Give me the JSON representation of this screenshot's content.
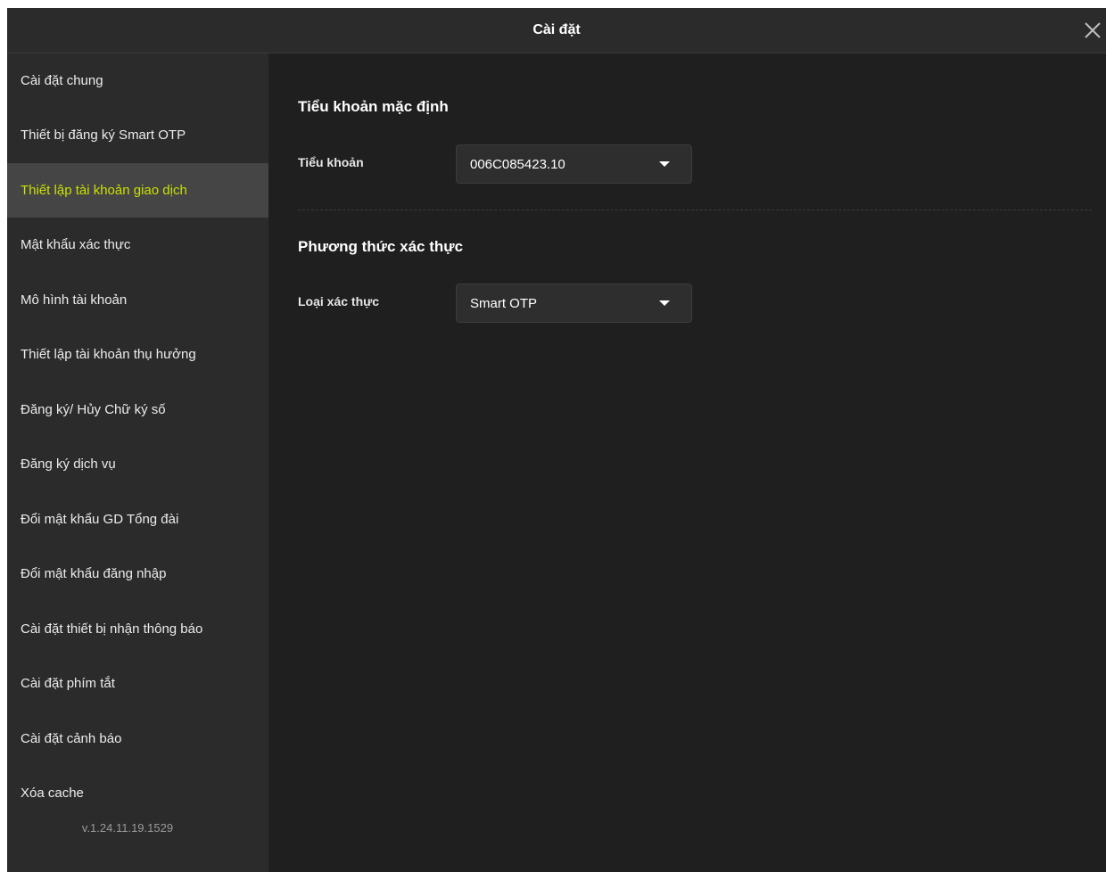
{
  "window": {
    "title": "Cài đặt",
    "close_icon": "close-icon"
  },
  "sidebar": {
    "items": [
      {
        "label": "Cài đặt chung"
      },
      {
        "label": "Thiết bị đăng ký Smart OTP"
      },
      {
        "label": "Thiết lập tài khoản giao dịch",
        "active": true
      },
      {
        "label": "Mật khẩu xác thực"
      },
      {
        "label": "Mô hình tài khoản"
      },
      {
        "label": "Thiết lập tài khoản thụ hưởng"
      },
      {
        "label": "Đăng ký/ Hủy Chữ ký số"
      },
      {
        "label": "Đăng ký dịch vụ"
      },
      {
        "label": "Đổi mật khẩu GD Tổng đài"
      },
      {
        "label": "Đổi mật khẩu đăng nhập"
      },
      {
        "label": "Cài đặt thiết bị nhận thông báo"
      },
      {
        "label": "Cài đặt phím tắt"
      },
      {
        "label": "Cài đặt cảnh báo"
      },
      {
        "label": "Xóa cache"
      }
    ],
    "version": "v.1.24.11.19.1529"
  },
  "main": {
    "default_subaccount": {
      "title": "Tiểu khoản mặc định",
      "field_label": "Tiểu khoản",
      "selected": "006C085423.10"
    },
    "auth_method": {
      "title": "Phương thức xác thực",
      "field_label": "Loại xác thực",
      "selected": "Smart OTP"
    }
  },
  "colors": {
    "background": "#1f1f1f",
    "sidebar": "#2b2b2b",
    "active_item_bg": "#454545",
    "active_item_text": "#c9e000",
    "text": "#ececec"
  }
}
